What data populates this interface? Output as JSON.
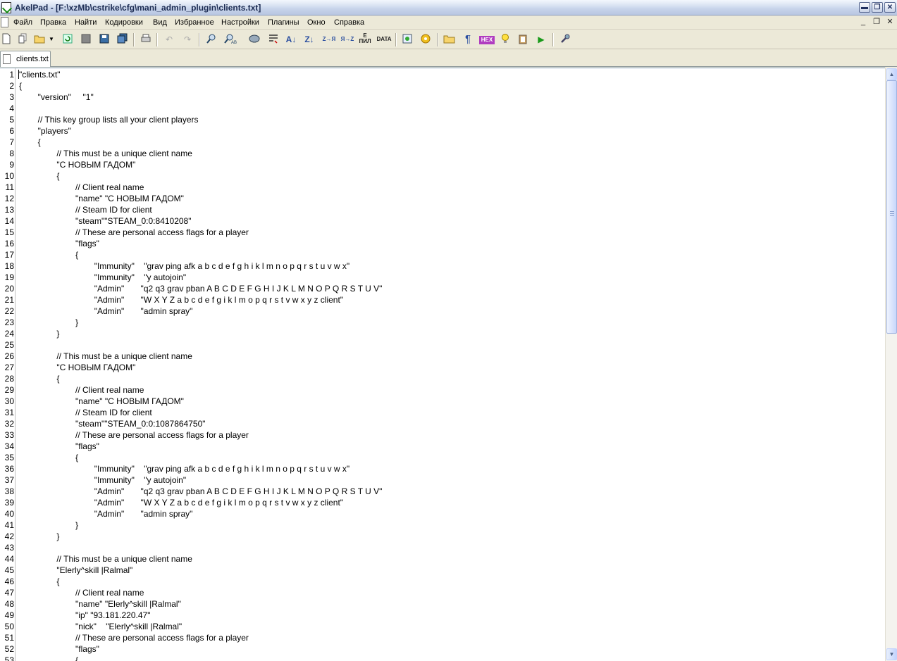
{
  "window": {
    "title": "AkelPad - [F:\\xzMb\\cstrike\\cfg\\mani_admin_plugin\\clients.txt]",
    "min_glyph": "▬",
    "max_glyph": "❐",
    "close_glyph": "✕"
  },
  "menu": {
    "items": [
      "Файл",
      "Правка",
      "Найти",
      "Кодировки",
      "Вид",
      "Избранное",
      "Настройки",
      "Плагины",
      "Окно",
      "Справка"
    ],
    "doc_min_glyph": "_",
    "doc_restore_glyph": "❐",
    "doc_close_glyph": "✕"
  },
  "toolbar": {
    "case_upper": "Z→Я",
    "case_lower": "Я→Z",
    "translit": "Е ПИЛ",
    "data": "DATA",
    "hex": "HEX"
  },
  "tabs": [
    {
      "label": "clients.txt"
    }
  ],
  "editor": {
    "lines": [
      {
        "n": "1",
        "text": "\"clients.txt\""
      },
      {
        "n": "2",
        "text": "{"
      },
      {
        "n": "3",
        "text": "        \"version\"     \"1\""
      },
      {
        "n": "4",
        "text": ""
      },
      {
        "n": "5",
        "text": "        // This key group lists all your client players"
      },
      {
        "n": "6",
        "text": "        \"players\""
      },
      {
        "n": "7",
        "text": "        {"
      },
      {
        "n": "8",
        "text": "                // This must be a unique client name"
      },
      {
        "n": "9",
        "text": "                \"С НОВЫМ ГАДОМ\""
      },
      {
        "n": "10",
        "text": "                {"
      },
      {
        "n": "11",
        "text": "                        // Client real name"
      },
      {
        "n": "12",
        "text": "                        \"name\" \"С НОВЫМ ГАДОМ\""
      },
      {
        "n": "13",
        "text": "                        // Steam ID for client"
      },
      {
        "n": "14",
        "text": "                        \"steam\"\"STEAM_0:0:8410208\""
      },
      {
        "n": "15",
        "text": "                        // These are personal access flags for a player"
      },
      {
        "n": "16",
        "text": "                        \"flags\""
      },
      {
        "n": "17",
        "text": "                        {"
      },
      {
        "n": "18",
        "text": "                                \"Immunity\"    \"grav ping afk a b c d e f g h i k l m n o p q r s t u v w x\""
      },
      {
        "n": "19",
        "text": "                                \"Immunity\"    \"y autojoin\""
      },
      {
        "n": "20",
        "text": "                                \"Admin\"       \"q2 q3 grav pban A B C D E F G H I J K L M N O P Q R S T U V\""
      },
      {
        "n": "21",
        "text": "                                \"Admin\"       \"W X Y Z a b c d e f g i k l m o p q r s t v w x y z client\""
      },
      {
        "n": "22",
        "text": "                                \"Admin\"       \"admin spray\""
      },
      {
        "n": "23",
        "text": "                        }"
      },
      {
        "n": "24",
        "text": "                }"
      },
      {
        "n": "25",
        "text": ""
      },
      {
        "n": "26",
        "text": "                // This must be a unique client name"
      },
      {
        "n": "27",
        "text": "                \"С НОВЫМ ГАДОМ\""
      },
      {
        "n": "28",
        "text": "                {"
      },
      {
        "n": "29",
        "text": "                        // Client real name"
      },
      {
        "n": "30",
        "text": "                        \"name\" \"С НОВЫМ ГАДОМ\""
      },
      {
        "n": "31",
        "text": "                        // Steam ID for client"
      },
      {
        "n": "32",
        "text": "                        \"steam\"\"STEAM_0:0:1087864750\""
      },
      {
        "n": "33",
        "text": "                        // These are personal access flags for a player"
      },
      {
        "n": "34",
        "text": "                        \"flags\""
      },
      {
        "n": "35",
        "text": "                        {"
      },
      {
        "n": "36",
        "text": "                                \"Immunity\"    \"grav ping afk a b c d e f g h i k l m n o p q r s t u v w x\""
      },
      {
        "n": "37",
        "text": "                                \"Immunity\"    \"y autojoin\""
      },
      {
        "n": "38",
        "text": "                                \"Admin\"       \"q2 q3 grav pban A B C D E F G H I J K L M N O P Q R S T U V\""
      },
      {
        "n": "39",
        "text": "                                \"Admin\"       \"W X Y Z a b c d e f g i k l m o p q r s t v w x y z client\""
      },
      {
        "n": "40",
        "text": "                                \"Admin\"       \"admin spray\""
      },
      {
        "n": "41",
        "text": "                        }"
      },
      {
        "n": "42",
        "text": "                }"
      },
      {
        "n": "43",
        "text": ""
      },
      {
        "n": "44",
        "text": "                // This must be a unique client name"
      },
      {
        "n": "45",
        "text": "                \"Elerly^skill |Ralmal\""
      },
      {
        "n": "46",
        "text": "                {"
      },
      {
        "n": "47",
        "text": "                        // Client real name"
      },
      {
        "n": "48",
        "text": "                        \"name\" \"Elerly^skill |Ralmal\""
      },
      {
        "n": "49",
        "text": "                        \"ip\" \"93.181.220.47\""
      },
      {
        "n": "50",
        "text": "                        \"nick\"    \"Elerly^skill |Ralmal\""
      },
      {
        "n": "51",
        "text": "                        // These are personal access flags for a player"
      },
      {
        "n": "52",
        "text": "                        \"flags\""
      },
      {
        "n": "53",
        "text": "                        {"
      }
    ]
  },
  "scrollbar": {
    "up_glyph": "▲",
    "down_glyph": "▼"
  }
}
